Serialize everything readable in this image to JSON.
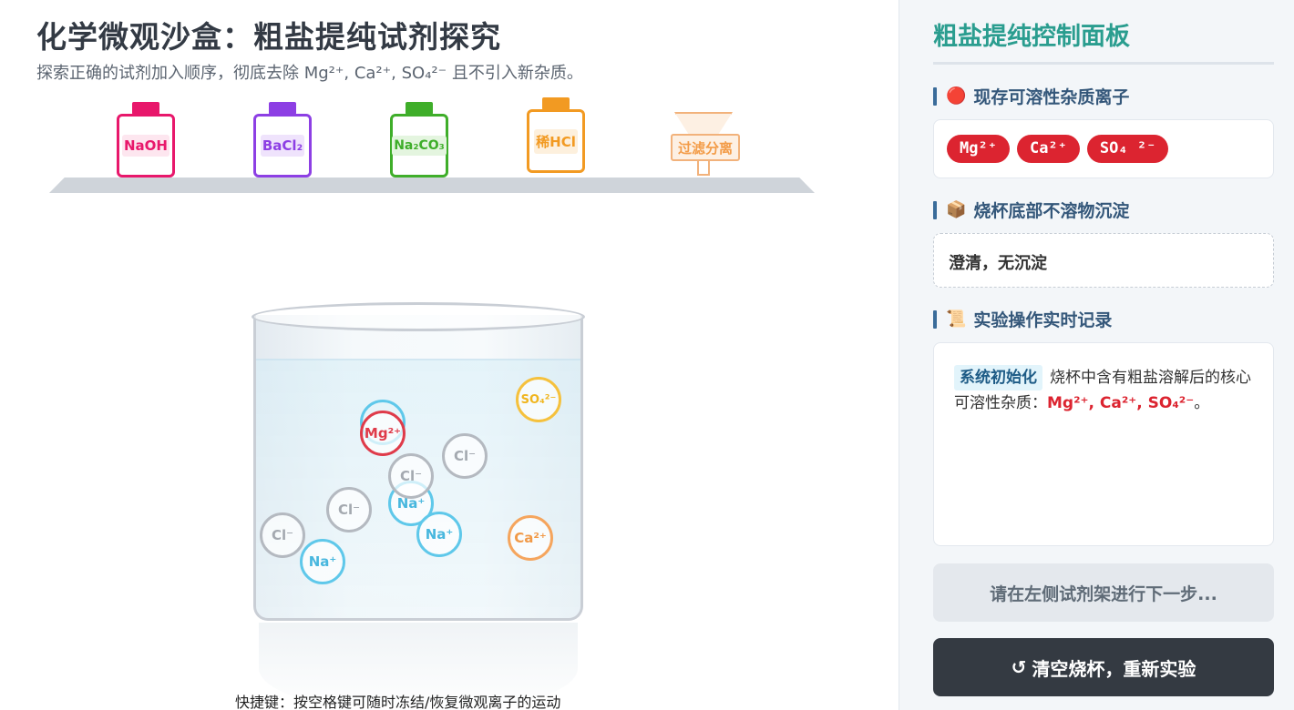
{
  "stage": {
    "title": "化学微观沙盒：粗盐提纯试剂探究",
    "subtitle": "探索正确的试剂加入顺序，彻底去除 Mg²⁺, Ca²⁺, SO₄²⁻ 且不引入新杂质。",
    "reagents": [
      {
        "label": "NaOH",
        "color": "#e8176b",
        "tint": "#fde6ef"
      },
      {
        "label": "BaCl₂",
        "color": "#8d3fe4",
        "tint": "#efe3fc"
      },
      {
        "label": "Na₂CO₃",
        "color": "#3fae2a",
        "tint": "#e4f5df"
      },
      {
        "label": "稀HCl",
        "color": "#f29a22",
        "tint": "#fdf0dd"
      }
    ],
    "filter_label": "过滤分离",
    "ions": {
      "mg": "Mg²⁺",
      "so4": "SO₄²⁻",
      "ca": "Ca²⁺",
      "na": "Na⁺",
      "cl": "Cl⁻"
    },
    "hint": "快捷键：按空格键可随时冻结/恢复微观离子的运动"
  },
  "panel": {
    "title": "粗盐提纯控制面板",
    "sections": {
      "ions_heading": "现存可溶性杂质离子",
      "ions_icon": "🔴",
      "precipitate_heading": "烧杯底部不溶物沉淀",
      "precipitate_icon": "📦",
      "log_heading": "实验操作实时记录",
      "log_icon": "📜"
    },
    "impurity_chips": [
      "Mg²⁺",
      "Ca²⁺",
      "SO₄ ²⁻"
    ],
    "precipitate_text": "澄清，无沉淀",
    "log": {
      "tag": "系统初始化",
      "text": "烧杯中含有粗盐溶解后的核心可溶性杂质：",
      "highlight": "Mg²⁺, Ca²⁺, SO₄²⁻",
      "end": "。"
    },
    "wait_button": "请在左侧试剂架进行下一步...",
    "reset_icon": "↺",
    "reset_button": "清空烧杯，重新实验"
  }
}
